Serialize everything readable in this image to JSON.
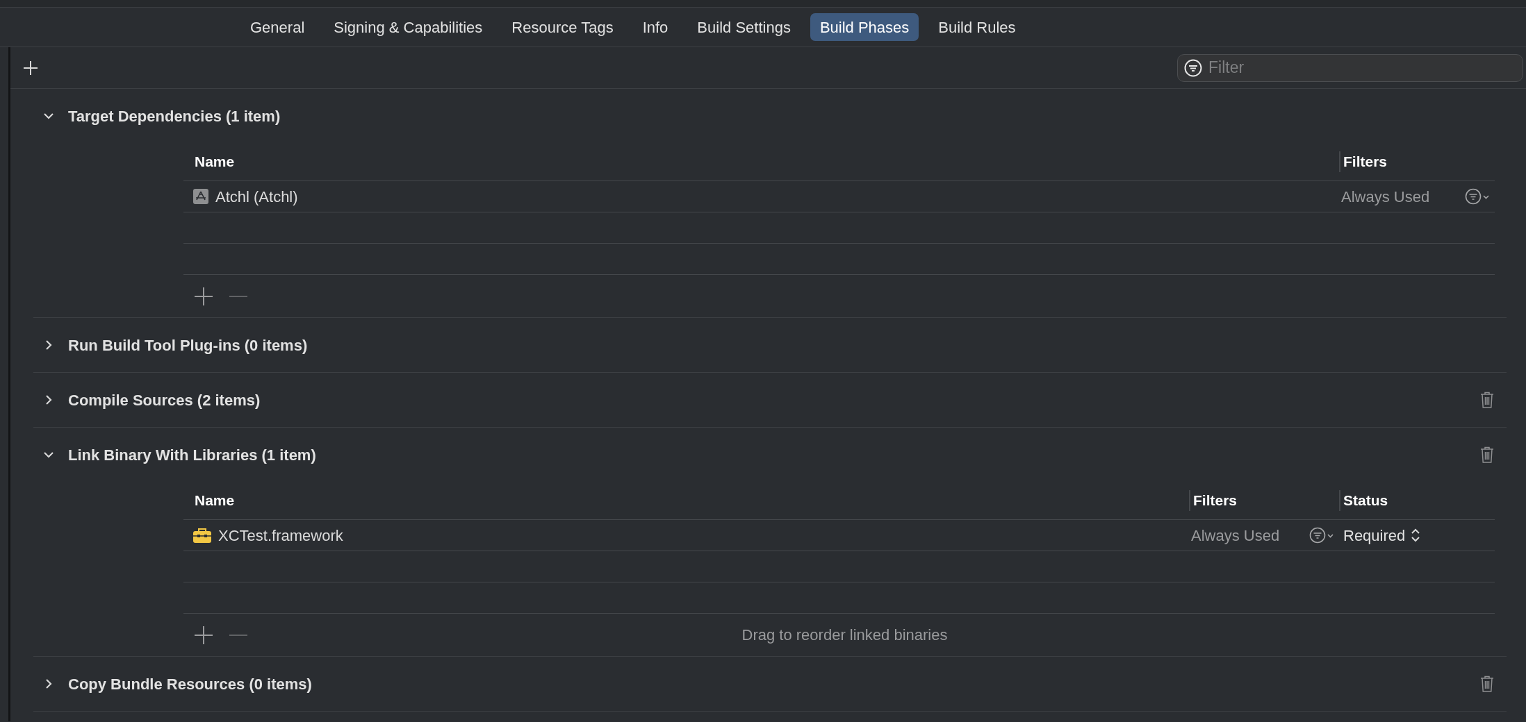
{
  "tabs": [
    {
      "label": "General",
      "selected": false
    },
    {
      "label": "Signing & Capabilities",
      "selected": false
    },
    {
      "label": "Resource Tags",
      "selected": false
    },
    {
      "label": "Info",
      "selected": false
    },
    {
      "label": "Build Settings",
      "selected": false
    },
    {
      "label": "Build Phases",
      "selected": true
    },
    {
      "label": "Build Rules",
      "selected": false
    }
  ],
  "filter": {
    "placeholder": "Filter"
  },
  "sections": [
    {
      "title": "Target Dependencies (1 item)",
      "expanded": true,
      "deletable": false,
      "table": {
        "columns": [
          "Name",
          "Filters"
        ],
        "rows": [
          {
            "kind": "target",
            "name": "Atchl (Atchl)",
            "filters": "Always Used"
          }
        ]
      }
    },
    {
      "title": "Run Build Tool Plug-ins (0 items)",
      "expanded": false,
      "deletable": false
    },
    {
      "title": "Compile Sources (2 items)",
      "expanded": false,
      "deletable": true
    },
    {
      "title": "Link Binary With Libraries (1 item)",
      "expanded": true,
      "deletable": true,
      "table": {
        "columns": [
          "Name",
          "Filters",
          "Status"
        ],
        "rows": [
          {
            "kind": "framework",
            "name": "XCTest.framework",
            "filters": "Always Used",
            "status": "Required"
          }
        ],
        "hint": "Drag to reorder linked binaries"
      }
    },
    {
      "title": "Copy Bundle Resources (0 items)",
      "expanded": false,
      "deletable": true
    }
  ]
}
